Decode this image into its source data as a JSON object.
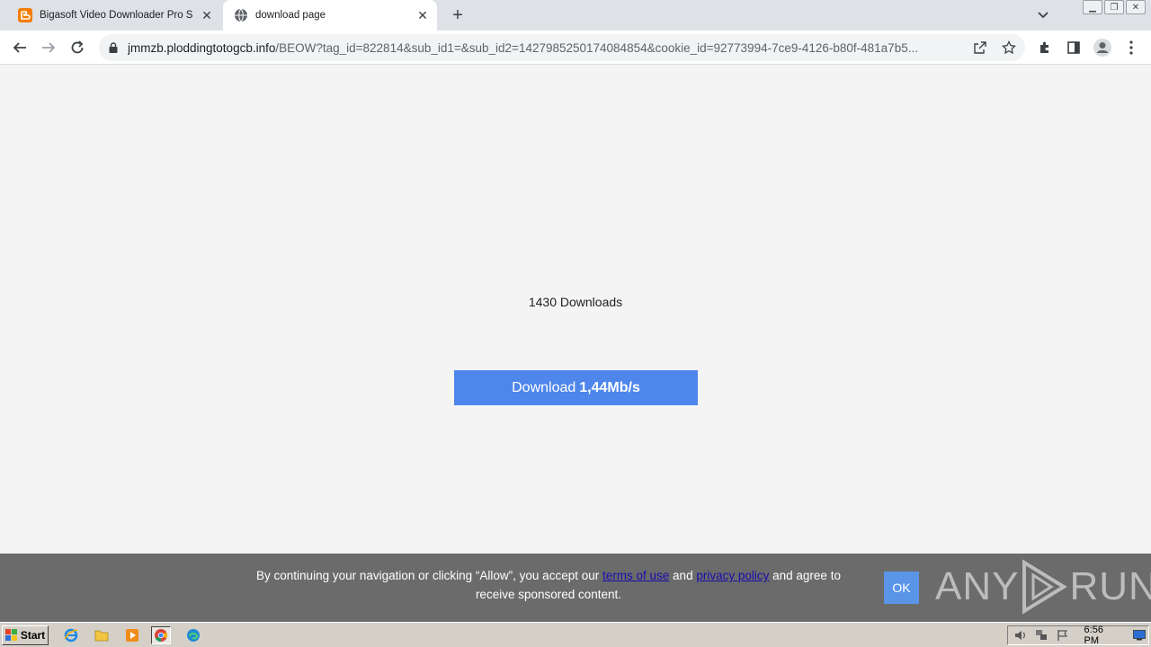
{
  "browser": {
    "tabs": [
      {
        "title": "Bigasoft Video Downloader Pro Serial",
        "active": false,
        "icon": "blogger-icon"
      },
      {
        "title": "download page",
        "active": true,
        "icon": "globe-icon"
      }
    ],
    "url_host": "jmmzb.ploddingtotogcb.info",
    "url_path": "/BEOW?tag_id=822814&sub_id1=&sub_id2=1427985250174084854&cookie_id=92773994-7ce9-4126-b80f-481a7b5..."
  },
  "page": {
    "downloads_count": "1430 Downloads",
    "download_button": {
      "label": "Download",
      "speed": "1,44Mb/s"
    }
  },
  "cookie_banner": {
    "text_before": "By continuing your navigation or clicking “Allow”, you accept our",
    "terms_link": "terms of use",
    "text_and": "and",
    "privacy_link": "privacy policy",
    "text_after": "and agree to receive sponsored content.",
    "ok_label": "OK"
  },
  "watermark": {
    "text_left": "ANY",
    "text_right": "RUN"
  },
  "taskbar": {
    "start_label": "Start",
    "clock": "6:56 PM"
  },
  "colors": {
    "accent_button": "#4f86ec",
    "banner_bg": "#6b6b6b",
    "link": "#1a0dab"
  }
}
